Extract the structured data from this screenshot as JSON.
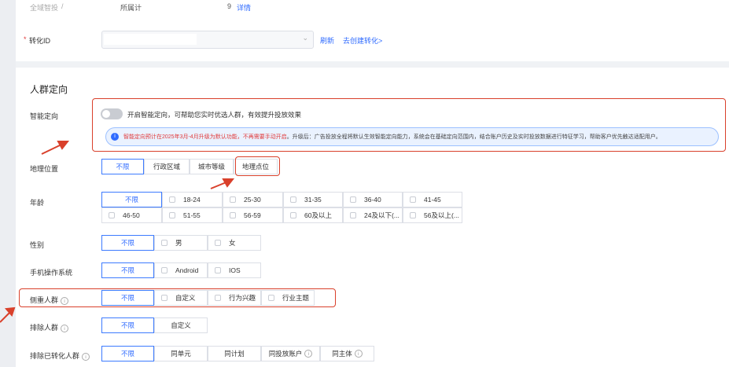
{
  "top": {
    "campaign_label": "全域智投",
    "belong_label": "所属计",
    "count": "9",
    "detail_link": "详情"
  },
  "conversion": {
    "label": "转化ID",
    "refresh": "刷新",
    "create_link": "去创建转化>"
  },
  "section_title": "人群定向",
  "smart": {
    "label": "智能定向",
    "toggle_text": "开启智能定向，可帮助您实时优选人群，有效提升投放效果",
    "notice_red": "智能定向预计在2025年3月-4月升级为默认功能，不再需要手动开启",
    "notice_rest": "。升级后：广告投放全程将默认生效智能定向能力，系统会在基础定向范围内，结合账户历史及实时投放数据进行特征学习，帮助客户优先触达适配用户。"
  },
  "geo": {
    "label": "地理位置",
    "options": [
      "不限",
      "行政区域",
      "城市等级",
      "地理点位"
    ]
  },
  "age": {
    "label": "年龄",
    "row1": [
      "不限",
      "18-24",
      "25-30",
      "31-35",
      "36-40",
      "41-45"
    ],
    "row2": [
      "46-50",
      "51-55",
      "56-59",
      "60及以上",
      "24及以下(...",
      "56及以上(..."
    ]
  },
  "gender": {
    "label": "性别",
    "options": [
      "不限",
      "男",
      "女"
    ]
  },
  "os": {
    "label": "手机操作系统",
    "options": [
      "不限",
      "Android",
      "IOS"
    ]
  },
  "focus": {
    "label": "侧重人群",
    "options": [
      "不限",
      "自定义",
      "行为兴趣",
      "行业主题"
    ]
  },
  "exclude": {
    "label": "排除人群",
    "options": [
      "不限",
      "自定义"
    ]
  },
  "exclude_converted": {
    "label": "排除已转化人群",
    "options": [
      "不限",
      "同单元",
      "同计划",
      "同投放账户",
      "同主体"
    ]
  },
  "colors": {
    "accent": "#2f6bff",
    "annotation": "#d9402b"
  }
}
